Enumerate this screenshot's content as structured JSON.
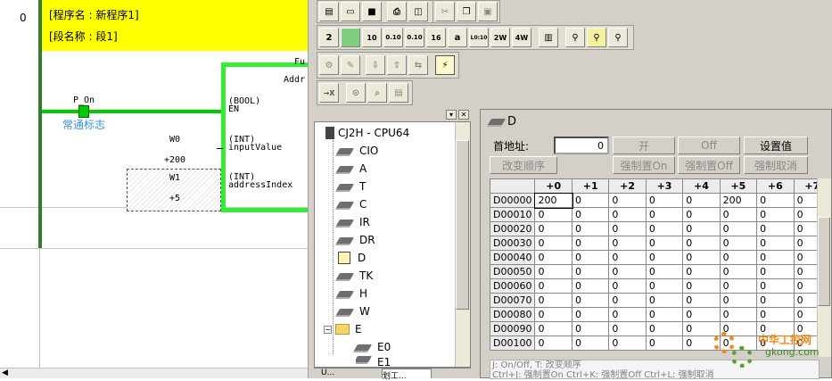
{
  "ladder": {
    "rung_number": "0",
    "program_label": "[程序名 : 新程序1]",
    "section_label": "[段名称 : 段1]",
    "contact_address": "P_On",
    "contact_comment": "常通标志",
    "fb_top_label_1": "Fu",
    "fb_top_label_2": "Addr",
    "param_en_type": "(BOOL)",
    "param_en": "EN",
    "param_input_type": "(INT)",
    "param_input": "inputValue",
    "param_index_type": "(INT)",
    "param_index": "addressIndex",
    "operand_w0": "W0",
    "operand_200": "+200",
    "operand_w1": "W1",
    "operand_5": "+5"
  },
  "toolbar": {
    "row2_labels": [
      "2",
      "",
      "10",
      "0.10",
      "0.10",
      "16",
      "a",
      "L0:10",
      "2W",
      "4W",
      "",
      "",
      "",
      ""
    ],
    "row4_labels": [
      "→X",
      "",
      "",
      ""
    ]
  },
  "tree": {
    "root": "CJ2H - CPU64",
    "items": [
      "CIO",
      "A",
      "T",
      "C",
      "IR",
      "DR",
      "D",
      "TK",
      "H",
      "W",
      "E",
      "E0",
      "E1"
    ],
    "tabs": [
      "U...",
      "划工..."
    ]
  },
  "dwin": {
    "title": "D",
    "start_address_label": "首地址:",
    "start_address_value": "0",
    "btn_on": "开",
    "btn_off": "Off",
    "btn_set": "设置值",
    "btn_change_order": "改变顺序",
    "btn_force_on": "强制置On",
    "btn_force_off": "强制置Off",
    "btn_force_cancel": "强制取消",
    "columns": [
      "",
      "+0",
      "+1",
      "+2",
      "+3",
      "+4",
      "+5",
      "+6",
      "+7"
    ],
    "rows": [
      [
        "D00000",
        "200",
        "0",
        "0",
        "0",
        "0",
        "200",
        "0",
        "0"
      ],
      [
        "D00010",
        "0",
        "0",
        "0",
        "0",
        "0",
        "0",
        "0",
        "0"
      ],
      [
        "D00020",
        "0",
        "0",
        "0",
        "0",
        "0",
        "0",
        "0",
        "0"
      ],
      [
        "D00030",
        "0",
        "0",
        "0",
        "0",
        "0",
        "0",
        "0",
        "0"
      ],
      [
        "D00040",
        "0",
        "0",
        "0",
        "0",
        "0",
        "0",
        "0",
        "0"
      ],
      [
        "D00050",
        "0",
        "0",
        "0",
        "0",
        "0",
        "0",
        "0",
        "0"
      ],
      [
        "D00060",
        "0",
        "0",
        "0",
        "0",
        "0",
        "0",
        "0",
        "0"
      ],
      [
        "D00070",
        "0",
        "0",
        "0",
        "0",
        "0",
        "0",
        "0",
        "0"
      ],
      [
        "D00080",
        "0",
        "0",
        "0",
        "0",
        "0",
        "0",
        "0",
        "0"
      ],
      [
        "D00090",
        "0",
        "0",
        "0",
        "0",
        "0",
        "0",
        "0",
        "0"
      ],
      [
        "D00100",
        "0",
        "0",
        "0",
        "0",
        "0",
        "0",
        "0",
        "0"
      ]
    ],
    "hint_line1": "J: On/Off,    T: 改变顺序",
    "hint_line2": "Ctrl+J: 强制置On   Ctrl+K: 强制置Off   Ctrl+L: 强制取消"
  },
  "watermark": {
    "text1": "中华工控网",
    "text2": "gkong.com"
  },
  "colors": {
    "yellow": "#ffff00",
    "rung_green": "#00cc00",
    "fb_border": "#33ee33",
    "comment_blue": "#3b8fd8",
    "dark_green_bar": "#2f7f2f"
  }
}
